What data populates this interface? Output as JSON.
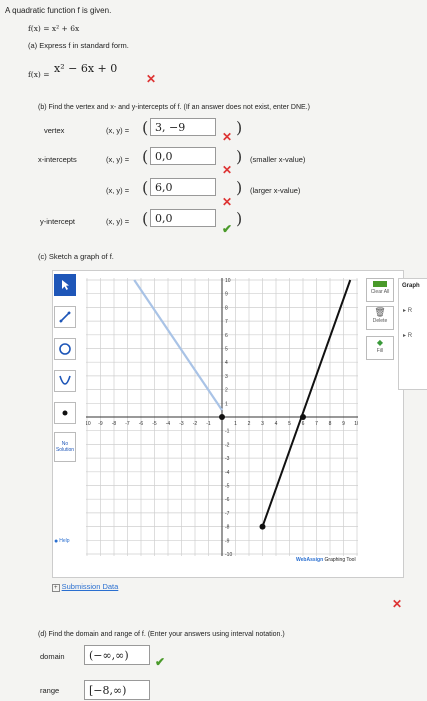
{
  "header": {
    "intro": "A quadratic function f is given.",
    "function": "f(x) = x² + 6x"
  },
  "part_a": {
    "prompt": "(a) Express f in standard form.",
    "lhs": "f(x) =",
    "answer": "x² − 6x + 0"
  },
  "part_b": {
    "prompt": "(b) Find the vertex and x- and y-intercepts of f. (If an answer does not exist, enter DNE.)",
    "rows": [
      {
        "label": "vertex",
        "xy": "(x, y) =",
        "value": "3, −9",
        "status": "incorrect",
        "hint": ""
      },
      {
        "label": "x-intercepts",
        "xy": "(x, y) =",
        "value": "0,0",
        "status": "incorrect",
        "hint": "(smaller x-value)"
      },
      {
        "label": "",
        "xy": "(x, y) =",
        "value": "6,0",
        "status": "incorrect",
        "hint": "(larger x-value)"
      },
      {
        "label": "y-intercept",
        "xy": "(x, y) =",
        "value": "0,0",
        "status": "correct",
        "hint": ""
      }
    ]
  },
  "part_c": {
    "prompt": "(c) Sketch a graph of f.",
    "tools": {
      "no_solution": "No Solution",
      "help": "Help"
    },
    "right_buttons": {
      "clear_all": "Clear All",
      "delete": "Delete",
      "fill": "Fill"
    },
    "side_panel": {
      "title": "Graph",
      "items": [
        "R",
        "R"
      ]
    },
    "brand": "WebAssign",
    "brand_suffix": " Graphing Tool",
    "submission": "Submission Data",
    "x_ticks": [
      "-10",
      "-9",
      "-8",
      "-7",
      "-6",
      "-5",
      "-4",
      "-3",
      "-2",
      "-1",
      "1",
      "2",
      "3",
      "4",
      "5",
      "6",
      "7",
      "8",
      "9",
      "10"
    ],
    "y_ticks": [
      "10",
      "9",
      "8",
      "7",
      "6",
      "5",
      "4",
      "3",
      "2",
      "1",
      "-1",
      "-2",
      "-3",
      "-4",
      "-5",
      "-6",
      "-7",
      "-8",
      "-9",
      "-10"
    ],
    "status": "incorrect"
  },
  "part_d": {
    "prompt": "(d) Find the domain and range of f. (Enter your answers using interval notation.)",
    "domain_label": "domain",
    "domain_value": "(−∞,∞)",
    "domain_status": "correct",
    "range_label": "range",
    "range_value": "[−8,∞)"
  },
  "colors": {
    "incorrect": "#d33333",
    "correct": "#4a9a2a",
    "accent_blue": "#2a6fd0",
    "graph_line": "#111111",
    "faint_line": "#a9c3e6"
  }
}
